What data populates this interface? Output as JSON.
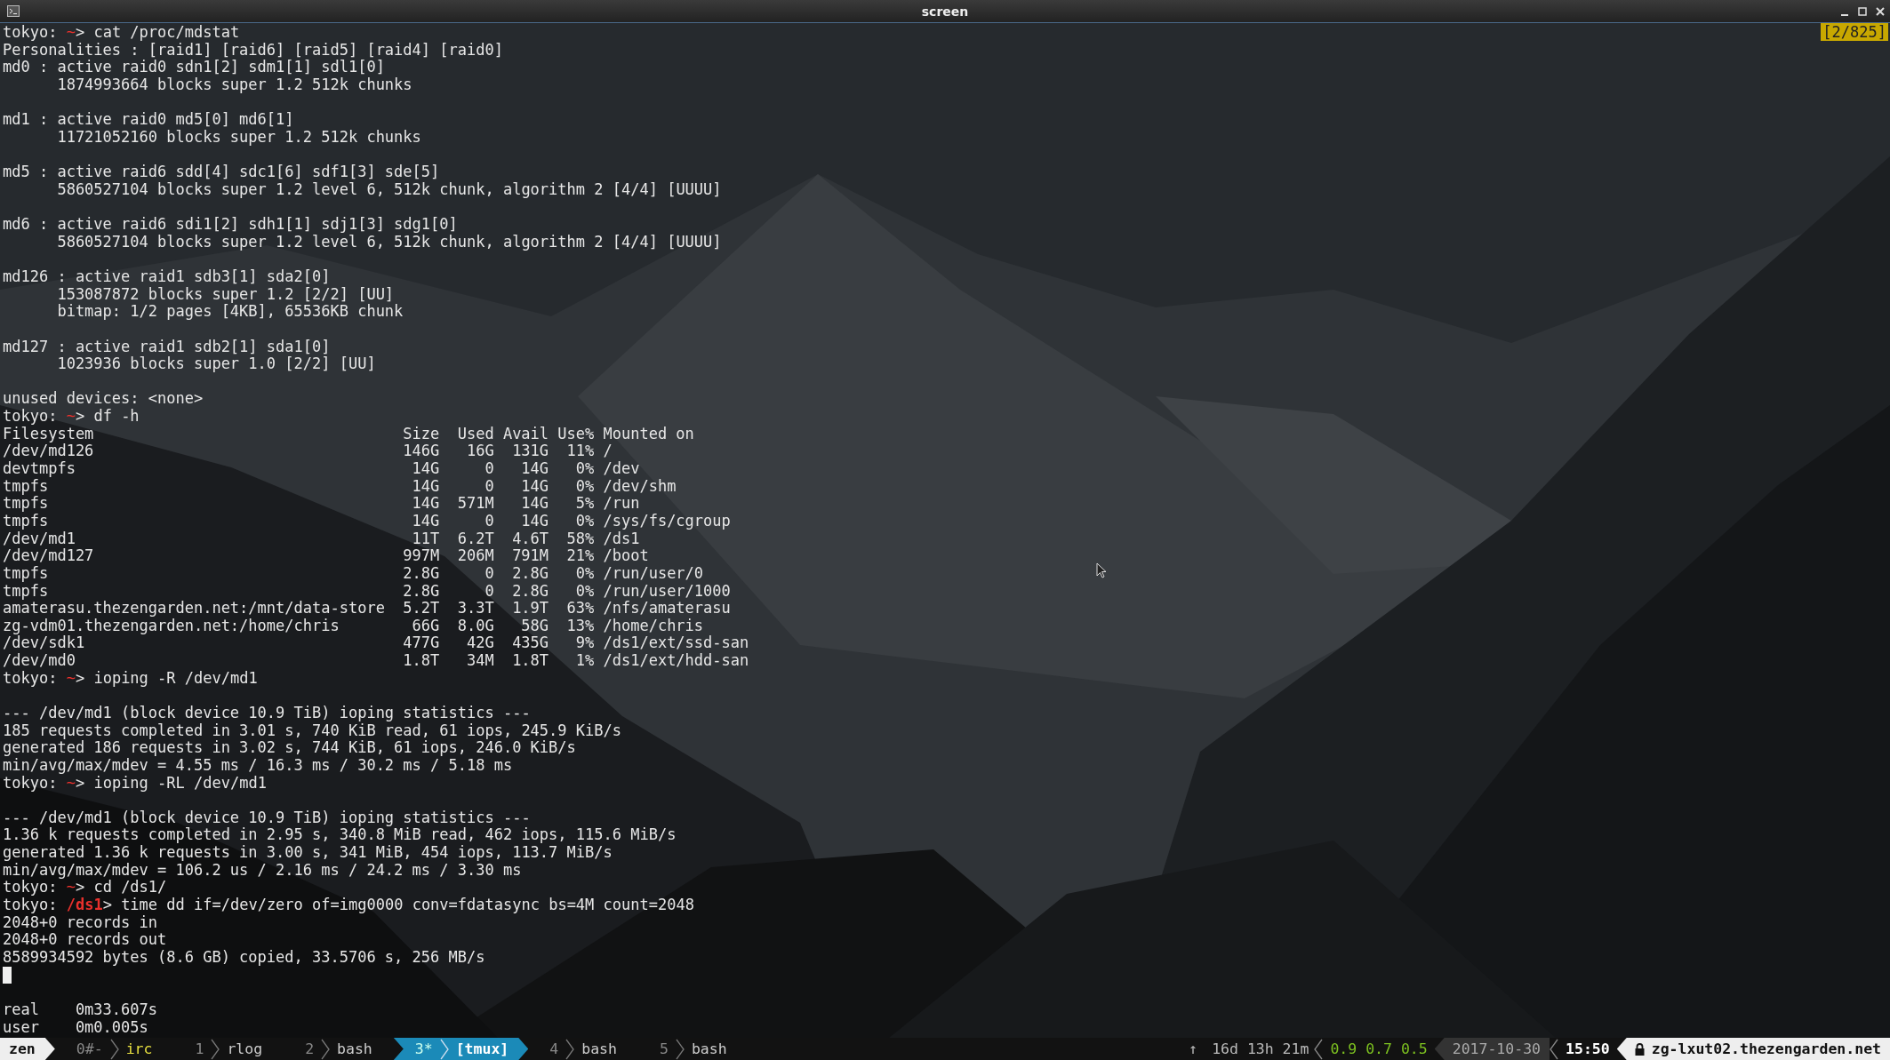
{
  "window": {
    "title": "screen"
  },
  "scroll_position": "[2/825]",
  "terminal": {
    "lines": [
      {
        "kind": "prompt",
        "host": "tokyo:",
        "dir": "~",
        "sign": ">",
        "command": "cat /proc/mdstat"
      },
      {
        "kind": "output",
        "text": "Personalities : [raid1] [raid6] [raid5] [raid4] [raid0]"
      },
      {
        "kind": "output",
        "text": "md0 : active raid0 sdn1[2] sdm1[1] sdl1[0]"
      },
      {
        "kind": "output",
        "indent": true,
        "text": "1874993664 blocks super 1.2 512k chunks"
      },
      {
        "kind": "blank"
      },
      {
        "kind": "output",
        "text": "md1 : active raid0 md5[0] md6[1]"
      },
      {
        "kind": "output",
        "indent": true,
        "text": "11721052160 blocks super 1.2 512k chunks"
      },
      {
        "kind": "blank"
      },
      {
        "kind": "output",
        "text": "md5 : active raid6 sdd[4] sdc1[6] sdf1[3] sde[5]"
      },
      {
        "kind": "output",
        "indent": true,
        "text": "5860527104 blocks super 1.2 level 6, 512k chunk, algorithm 2 [4/4] [UUUU]"
      },
      {
        "kind": "blank"
      },
      {
        "kind": "output",
        "text": "md6 : active raid6 sdi1[2] sdh1[1] sdj1[3] sdg1[0]"
      },
      {
        "kind": "output",
        "indent": true,
        "text": "5860527104 blocks super 1.2 level 6, 512k chunk, algorithm 2 [4/4] [UUUU]"
      },
      {
        "kind": "blank"
      },
      {
        "kind": "output",
        "text": "md126 : active raid1 sdb3[1] sda2[0]"
      },
      {
        "kind": "output",
        "indent": true,
        "text": "153087872 blocks super 1.2 [2/2] [UU]"
      },
      {
        "kind": "output",
        "indent": true,
        "text": "bitmap: 1/2 pages [4KB], 65536KB chunk"
      },
      {
        "kind": "blank"
      },
      {
        "kind": "output",
        "text": "md127 : active raid1 sdb2[1] sda1[0]"
      },
      {
        "kind": "output",
        "indent": true,
        "text": "1023936 blocks super 1.0 [2/2] [UU]"
      },
      {
        "kind": "blank"
      },
      {
        "kind": "output",
        "text": "unused devices: <none>"
      },
      {
        "kind": "prompt",
        "host": "tokyo:",
        "dir": "~",
        "sign": ">",
        "command": "df -h"
      },
      {
        "kind": "row",
        "cells": [
          "Filesystem",
          "Size",
          "Used",
          "Avail",
          "Use%",
          "Mounted on"
        ]
      },
      {
        "kind": "row",
        "cells": [
          "/dev/md126",
          "146G",
          "16G",
          "131G",
          "11%",
          "/"
        ]
      },
      {
        "kind": "row",
        "cells": [
          "devtmpfs",
          "14G",
          "0",
          "14G",
          "0%",
          "/dev"
        ]
      },
      {
        "kind": "row",
        "cells": [
          "tmpfs",
          "14G",
          "0",
          "14G",
          "0%",
          "/dev/shm"
        ]
      },
      {
        "kind": "row",
        "cells": [
          "tmpfs",
          "14G",
          "571M",
          "14G",
          "5%",
          "/run"
        ]
      },
      {
        "kind": "row",
        "cells": [
          "tmpfs",
          "14G",
          "0",
          "14G",
          "0%",
          "/sys/fs/cgroup"
        ]
      },
      {
        "kind": "row",
        "cells": [
          "/dev/md1",
          "11T",
          "6.2T",
          "4.6T",
          "58%",
          "/ds1"
        ]
      },
      {
        "kind": "row",
        "cells": [
          "/dev/md127",
          "997M",
          "206M",
          "791M",
          "21%",
          "/boot"
        ]
      },
      {
        "kind": "row",
        "cells": [
          "tmpfs",
          "2.8G",
          "0",
          "2.8G",
          "0%",
          "/run/user/0"
        ]
      },
      {
        "kind": "row",
        "cells": [
          "tmpfs",
          "2.8G",
          "0",
          "2.8G",
          "0%",
          "/run/user/1000"
        ]
      },
      {
        "kind": "row",
        "cells": [
          "amaterasu.thezengarden.net:/mnt/data-store",
          "5.2T",
          "3.3T",
          "1.9T",
          "63%",
          "/nfs/amaterasu"
        ]
      },
      {
        "kind": "row",
        "cells": [
          "zg-vdm01.thezengarden.net:/home/chris",
          "66G",
          "8.0G",
          "58G",
          "13%",
          "/home/chris"
        ]
      },
      {
        "kind": "row",
        "cells": [
          "/dev/sdk1",
          "477G",
          "42G",
          "435G",
          "9%",
          "/ds1/ext/ssd-san"
        ]
      },
      {
        "kind": "row",
        "cells": [
          "/dev/md0",
          "1.8T",
          "34M",
          "1.8T",
          "1%",
          "/ds1/ext/hdd-san"
        ]
      },
      {
        "kind": "prompt",
        "host": "tokyo:",
        "dir": "~",
        "sign": ">",
        "command": "ioping -R /dev/md1"
      },
      {
        "kind": "blank"
      },
      {
        "kind": "output",
        "text": "--- /dev/md1 (block device 10.9 TiB) ioping statistics ---"
      },
      {
        "kind": "output",
        "text": "185 requests completed in 3.01 s, 740 KiB read, 61 iops, 245.9 KiB/s"
      },
      {
        "kind": "output",
        "text": "generated 186 requests in 3.02 s, 744 KiB, 61 iops, 246.0 KiB/s"
      },
      {
        "kind": "output",
        "text": "min/avg/max/mdev = 4.55 ms / 16.3 ms / 30.2 ms / 5.18 ms"
      },
      {
        "kind": "prompt",
        "host": "tokyo:",
        "dir": "~",
        "sign": ">",
        "command": "ioping -RL /dev/md1"
      },
      {
        "kind": "blank"
      },
      {
        "kind": "output",
        "text": "--- /dev/md1 (block device 10.9 TiB) ioping statistics ---"
      },
      {
        "kind": "output",
        "text": "1.36 k requests completed in 2.95 s, 340.8 MiB read, 462 iops, 115.6 MiB/s"
      },
      {
        "kind": "output",
        "text": "generated 1.36 k requests in 3.00 s, 341 MiB, 454 iops, 113.7 MiB/s"
      },
      {
        "kind": "output",
        "text": "min/avg/max/mdev = 106.2 us / 2.16 ms / 24.2 ms / 3.30 ms"
      },
      {
        "kind": "prompt",
        "host": "tokyo:",
        "dir": "~",
        "sign": ">",
        "command": "cd /ds1/"
      },
      {
        "kind": "prompt",
        "host": "tokyo:",
        "dir": "/ds1",
        "sign": ">",
        "command": "time dd if=/dev/zero of=img0000 conv=fdatasync bs=4M count=2048"
      },
      {
        "kind": "output",
        "text": "2048+0 records in"
      },
      {
        "kind": "output",
        "text": "2048+0 records out"
      },
      {
        "kind": "output",
        "text": "8589934592 bytes (8.6 GB) copied, 33.5706 s, 256 MB/s"
      },
      {
        "kind": "cursor"
      },
      {
        "kind": "blank"
      },
      {
        "kind": "timing",
        "label": "real",
        "value": "0m33.607s"
      },
      {
        "kind": "timing",
        "label": "user",
        "value": "0m0.005s"
      }
    ]
  },
  "status_bar": {
    "session": "zen",
    "windows": [
      {
        "number": "0#-",
        "name": "irc",
        "selected": false,
        "activity": true
      },
      {
        "number": "1",
        "name": "rlog",
        "selected": false,
        "activity": false
      },
      {
        "number": "2",
        "name": "bash",
        "selected": false,
        "activity": false
      },
      {
        "number": "3*",
        "name": "[tmux]",
        "selected": true,
        "activity": false
      },
      {
        "number": "4",
        "name": "bash",
        "selected": false,
        "activity": false
      },
      {
        "number": "5",
        "name": "bash",
        "selected": false,
        "activity": false
      }
    ],
    "uptime_arrow": "↑",
    "uptime": "16d 13h 21m",
    "load": "0.9 0.7 0.5",
    "date": "2017-10-30",
    "time": "15:50",
    "host": "zg-lxut02.thezengarden.net"
  }
}
